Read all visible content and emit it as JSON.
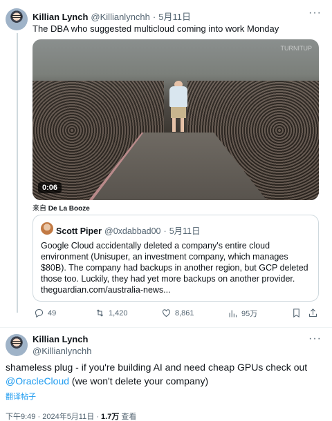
{
  "reply_tweet": {
    "author_name": "Killian Lynch",
    "author_handle": "@Killianlynchh",
    "separator": "·",
    "date": "5月11日",
    "more_glyph": "···",
    "text": "The DBA who suggested multicloud coming into work Monday",
    "media": {
      "duration": "0:06",
      "watermark": "TURNITUP"
    },
    "source_prefix": "来自",
    "source_name": "De La Booze",
    "quoted_tweet": {
      "author_name": "Scott Piper",
      "author_handle": "@0xdabbad00",
      "separator": "·",
      "date": "5月11日",
      "text": "Google Cloud accidentally deleted a company's entire cloud environment (Unisuper, an investment company, which manages $80B). The company had backups in another region, but GCP deleted those too. Luckily, they had yet more backups on another provider. theguardian.com/australia-news..."
    },
    "actions": {
      "replies": "49",
      "reposts": "1,420",
      "likes": "8,861",
      "views": "95万"
    }
  },
  "main_tweet": {
    "author_name": "Killian Lynch",
    "author_handle": "@Killianlynchh",
    "more_glyph": "···",
    "text_before": "shameless plug - if you're building AI and need cheap GPUs check out",
    "mention": "@OracleCloud",
    "text_after": " (we won't delete your company)",
    "translate_label": "翻译帖子",
    "time": "下午9:49",
    "separator": "·",
    "date": "2024年5月11日",
    "separator2": "·",
    "views_count": "1.7万",
    "views_label": "查看"
  },
  "colors": {
    "accent": "#1d9bf0",
    "text": "#0f1419",
    "muted": "#536471",
    "border": "#cfd9de"
  },
  "icons": [
    "reply-icon",
    "repost-icon",
    "like-icon",
    "views-icon",
    "bookmark-icon",
    "share-icon"
  ]
}
